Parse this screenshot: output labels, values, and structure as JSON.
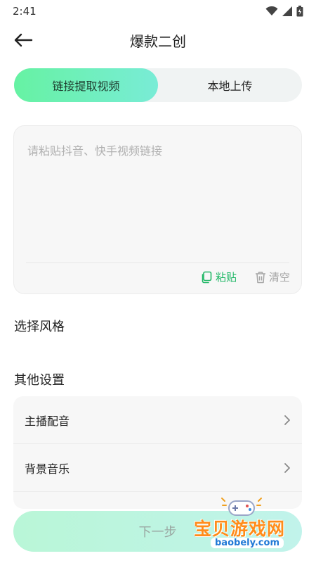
{
  "status_bar": {
    "time": "2:41"
  },
  "header": {
    "title": "爆款二创"
  },
  "tabs": [
    {
      "label": "链接提取视频",
      "active": true
    },
    {
      "label": "本地上传",
      "active": false
    }
  ],
  "link_input": {
    "value": "",
    "placeholder": "请粘贴抖音、快手视频链接"
  },
  "input_actions": {
    "paste_label": "粘贴",
    "clear_label": "清空"
  },
  "sections": {
    "style_title": "选择风格",
    "other_title": "其他设置"
  },
  "settings": [
    {
      "label": "主播配音"
    },
    {
      "label": "背景音乐"
    }
  ],
  "footer": {
    "next_label": "下一步"
  },
  "watermark": {
    "text": "宝贝游戏网",
    "url": "baobely.com"
  },
  "colors": {
    "accent_green": "#20b766",
    "tab_gradient_start": "#66f2a3",
    "tab_gradient_end": "#79ecd6"
  }
}
